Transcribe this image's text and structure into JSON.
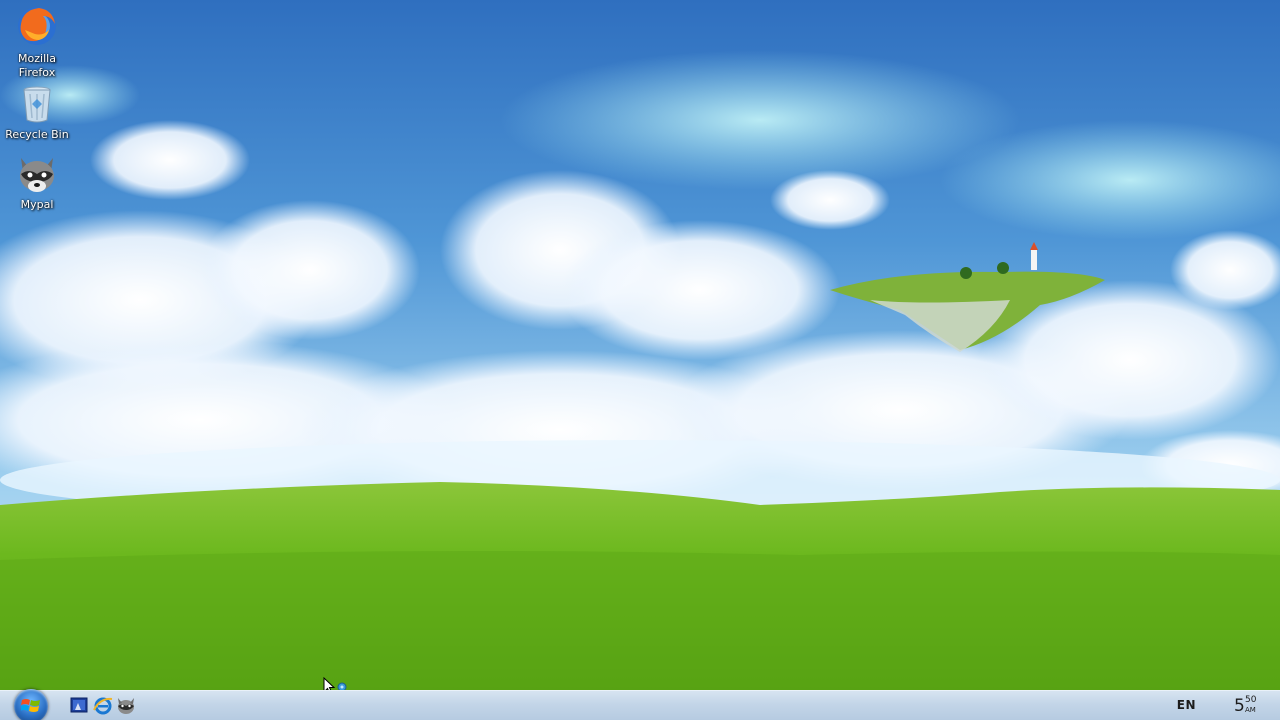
{
  "desktop": {
    "icons": [
      {
        "label": "Mozilla Firefox",
        "icon": "firefox-icon"
      },
      {
        "label": "Recycle Bin",
        "icon": "recycle-bin-icon"
      },
      {
        "label": "Mypal",
        "icon": "mypal-raccoon-icon"
      }
    ],
    "wallpaper": {
      "description_icon": "floating-island-wallpaper",
      "sky_color": "#3f86cf",
      "grass_color": "#6fbf1a"
    }
  },
  "taskbar": {
    "start_button_icon": "windows-logo-icon",
    "quick_launch": [
      {
        "icon": "show-desktop-icon"
      },
      {
        "icon": "internet-explorer-icon"
      },
      {
        "icon": "mypal-raccoon-icon"
      }
    ],
    "tray": {
      "language": "EN",
      "clock_hour": "5",
      "clock_minutes": "50",
      "clock_ampm": "AM"
    },
    "colors": {
      "bar_top": "#d7e4f1",
      "bar_bottom": "#b6cbe1"
    }
  }
}
